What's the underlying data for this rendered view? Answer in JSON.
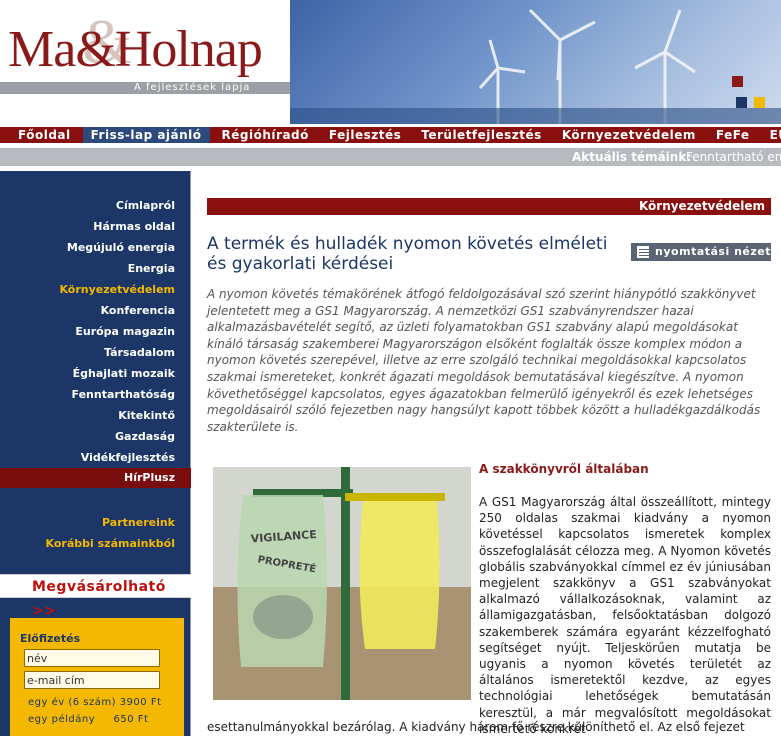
{
  "logo": {
    "title": "Ma&Holnap",
    "subtitle": "A fejlesztések lapja"
  },
  "nav": {
    "items": [
      {
        "label": "Főoldal"
      },
      {
        "label": "Friss-lap ajánló"
      },
      {
        "label": "Régióhíradó"
      },
      {
        "label": "Fejlesztés"
      },
      {
        "label": "Területfejlesztés"
      },
      {
        "label": "Környezetvédelem"
      },
      {
        "label": "FeFe"
      },
      {
        "label": "EU"
      }
    ],
    "active_index": 1
  },
  "topics": {
    "label": "Aktuális témáink:",
    "value": "Fenntartható ene"
  },
  "sidebar": {
    "items": [
      {
        "label": "Címlapról"
      },
      {
        "label": "Hármas oldal"
      },
      {
        "label": "Megújuló energia"
      },
      {
        "label": "Energia"
      },
      {
        "label": "Környezetvédelem"
      },
      {
        "label": "Konferencia"
      },
      {
        "label": "Európa magazin"
      },
      {
        "label": "Társadalom"
      },
      {
        "label": "Éghajlati mozaik"
      },
      {
        "label": "Fenntarthatóság"
      },
      {
        "label": "Kitekintő"
      },
      {
        "label": "Gazdaság"
      },
      {
        "label": "Vidékfejlesztés"
      }
    ],
    "hirplusz": "HírPlusz",
    "partners": "Partnereink",
    "archive": "Korábbi számainkból",
    "buy": "Megvásárolható >>",
    "subscription": {
      "title": "Előfizetés",
      "name_value": "név",
      "email_value": "e-mail cím",
      "price_year": "egy év (6 szám) 3900 Ft",
      "price_issue": "egy példány     650 Ft"
    }
  },
  "article": {
    "section": "Környezetvédelem",
    "title": "A termék és hulladék nyomon követés elméleti és gyakorlati kérdései",
    "print_label": "nyomtatási nézet",
    "lead": "A nyomon követés témakörének átfogó feldolgozásával szó szerint hiánypótló szakkönyvet jelentetett meg a GS1 Magyarország. A nemzetközi GS1 szabványrendszer hazai alkalmazásbavételét segítő, az üzleti folyamatokban GS1 szabvány alapú megoldásokat kínáló társaság szakemberei Magyarországon elsőként foglalták össze komplex módon a nyomon követés szerepével, illetve az erre szolgáló technikai megoldásokkal kapcsolatos szakmai ismereteket, konkrét ágazati megoldások bemutatásával kiegészítve. A nyomon követhetőséggel kapcsolatos, egyes ágazatokban felmerülő igényekről és ezek lehetséges megoldásairól szóló fejezetben nagy hangsúlyt kapott többek között a hulladékgazdálkodás szakterülete is.",
    "subhead": "A szakkönyvről általában",
    "body": "A GS1 Magyarország által összeállított, mintegy 250 oldalas szakmai kiadvány a nyomon követéssel kapcsolatos ismeretek komplex összefoglalását célozza meg. A Nyomon követés globális szabványokkal címmel ez év júniusában megjelent szakkönyv a GS1 szabványokat alkalmazó vállalkozásoknak, valamint az államigazgatásban, felsőoktatásban dolgozó szakemberek számára egyaránt kézzelfogható segítséget nyújt. Teljeskörűen mutatja be ugyanis a nyomon követés területét az általános ismeretektől kezdve, az egyes technológiai lehetőségek bemutatásán keresztül, a már megvalósított megoldásokat ismertető konkrét",
    "body_cont": "esettanulmányokkal bezárólag. A kiadvány három fő részre különíthető el. Az első fejezet",
    "photo_text_1": "VIGILANCE",
    "photo_text_2": "PROPRETÉ"
  }
}
